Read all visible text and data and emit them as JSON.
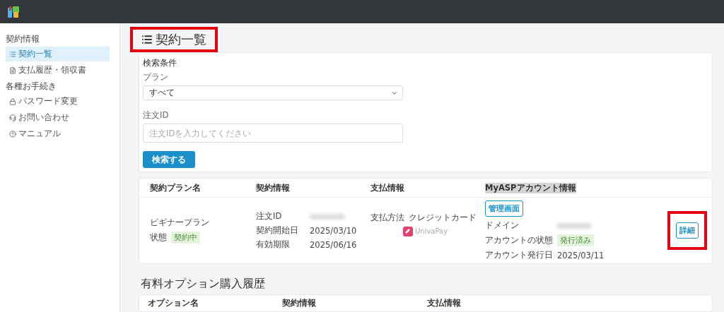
{
  "sidebar": {
    "sections": [
      {
        "heading": "契約情報",
        "items": [
          {
            "label": "契約一覧",
            "selected": true
          },
          {
            "label": "支払履歴・領収書",
            "selected": false
          }
        ]
      },
      {
        "heading": "各種お手続き",
        "items": [
          {
            "label": "パスワード変更",
            "selected": false
          },
          {
            "label": "お問い合わせ",
            "selected": false
          },
          {
            "label": "マニュアル",
            "selected": false
          }
        ]
      }
    ]
  },
  "page_title": {
    "text": "契約一覧",
    "highlighted": true
  },
  "search": {
    "title": "検索条件",
    "plan_label": "プラン",
    "plan_value": "すべて",
    "order_label": "注文ID",
    "order_placeholder": "注文IDを入力してください",
    "button": "検索する"
  },
  "contracts": {
    "columns": [
      "契約プラン名",
      "契約情報",
      "支払情報",
      "MyASPアカウント情報"
    ],
    "rows": [
      {
        "plan": "ビギナープラン",
        "status_label": "状態",
        "status": "契約中",
        "info": [
          {
            "label": "注文ID"
          },
          {
            "label": "契約開始日",
            "value": "2025/03/10"
          },
          {
            "label": "有効期限",
            "value": "2025/06/16"
          }
        ],
        "payment_label": "支払方法",
        "payment_method": "クレジットカード",
        "payment_logo": "UnivaPay",
        "admin_button": "管理画面",
        "account": [
          {
            "label": "ドメイン",
            "kind": "redacted"
          },
          {
            "label": "アカウントの状態",
            "kind": "badge",
            "value": "発行済み"
          },
          {
            "label": "アカウント発行日",
            "kind": "text",
            "value": "2025/03/11"
          }
        ],
        "detail_button": "詳細",
        "detail_highlighted": true
      }
    ]
  },
  "options": {
    "title": "有料オプション購入履歴",
    "columns": [
      "オプション名",
      "契約情報",
      "支払情報"
    ]
  }
}
